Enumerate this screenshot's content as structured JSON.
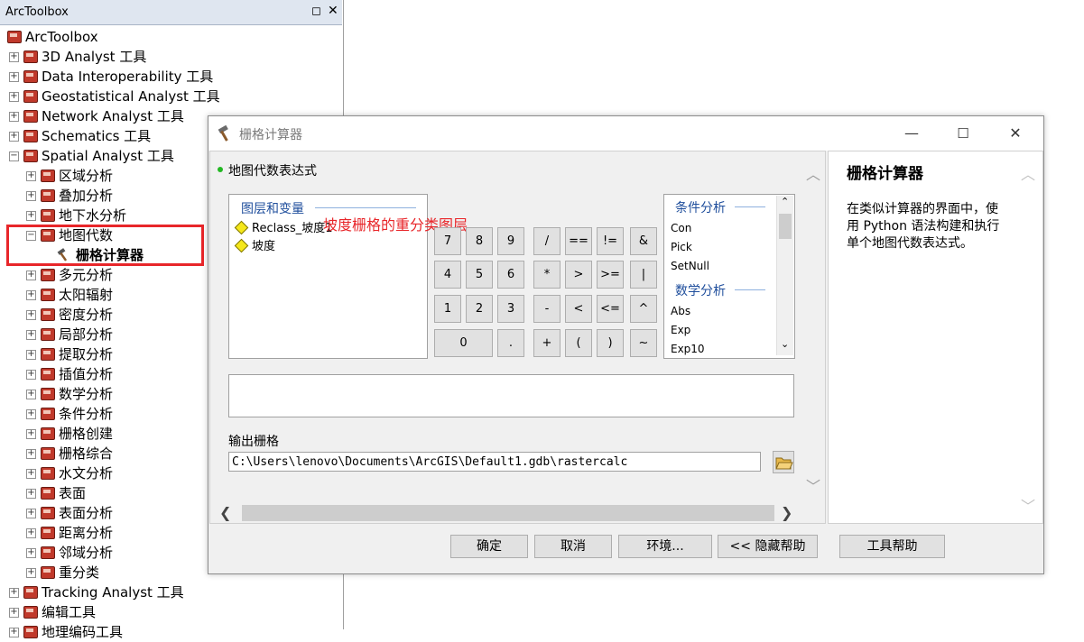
{
  "arctoolbox": {
    "title": "ArcToolbox",
    "root": "ArcToolbox",
    "toolboxes": [
      "3D Analyst 工具",
      "Data Interoperability 工具",
      "Geostatistical Analyst 工具",
      "Network Analyst 工具",
      "Schematics 工具",
      "Spatial Analyst 工具"
    ],
    "spatial_children": [
      "区域分析",
      "叠加分析",
      "地下水分析",
      "地图代数"
    ],
    "map_algebra_tool": "栅格计算器",
    "spatial_children_rest": [
      "多元分析",
      "太阳辐射",
      "密度分析",
      "局部分析",
      "提取分析",
      "插值分析",
      "数学分析",
      "条件分析",
      "栅格创建",
      "栅格综合",
      "水文分析",
      "表面",
      "表面分析",
      "距离分析",
      "邻域分析",
      "重分类"
    ],
    "toolboxes_after": [
      "Tracking Analyst 工具",
      "编辑工具",
      "地理编码工具"
    ]
  },
  "dialog": {
    "title": "栅格计算器",
    "expression_label": "地图代数表达式",
    "layers_title": "图层和变量",
    "layers": [
      "Reclass_坡度1",
      "坡度"
    ],
    "annotation": "坡度栅格的重分类图层",
    "keypad": [
      [
        "7",
        "8",
        "9",
        "/",
        "==",
        "!=",
        "&"
      ],
      [
        "4",
        "5",
        "6",
        "*",
        ">",
        ">=",
        "|"
      ],
      [
        "1",
        "2",
        "3",
        "-",
        "<",
        "<=",
        "^"
      ],
      [
        "0",
        ".",
        "+",
        "(",
        ")",
        "~"
      ]
    ],
    "functions": {
      "cond_title": "条件分析",
      "cond": [
        "Con",
        "Pick",
        "SetNull"
      ],
      "math_title": "数学分析",
      "math": [
        "Abs",
        "Exp",
        "Exp10"
      ]
    },
    "expression_value": "",
    "output_label": "输出栅格",
    "output_value": "C:\\Users\\lenovo\\Documents\\ArcGIS\\Default1.gdb\\rastercalc",
    "help_title": "栅格计算器",
    "help_body": "在类似计算器的界面中，使用 Python 语法构建和执行单个地图代数表达式。",
    "buttons": {
      "ok": "确定",
      "cancel": "取消",
      "env": "环境...",
      "hide_help": "<< 隐藏帮助",
      "tool_help": "工具帮助"
    }
  }
}
